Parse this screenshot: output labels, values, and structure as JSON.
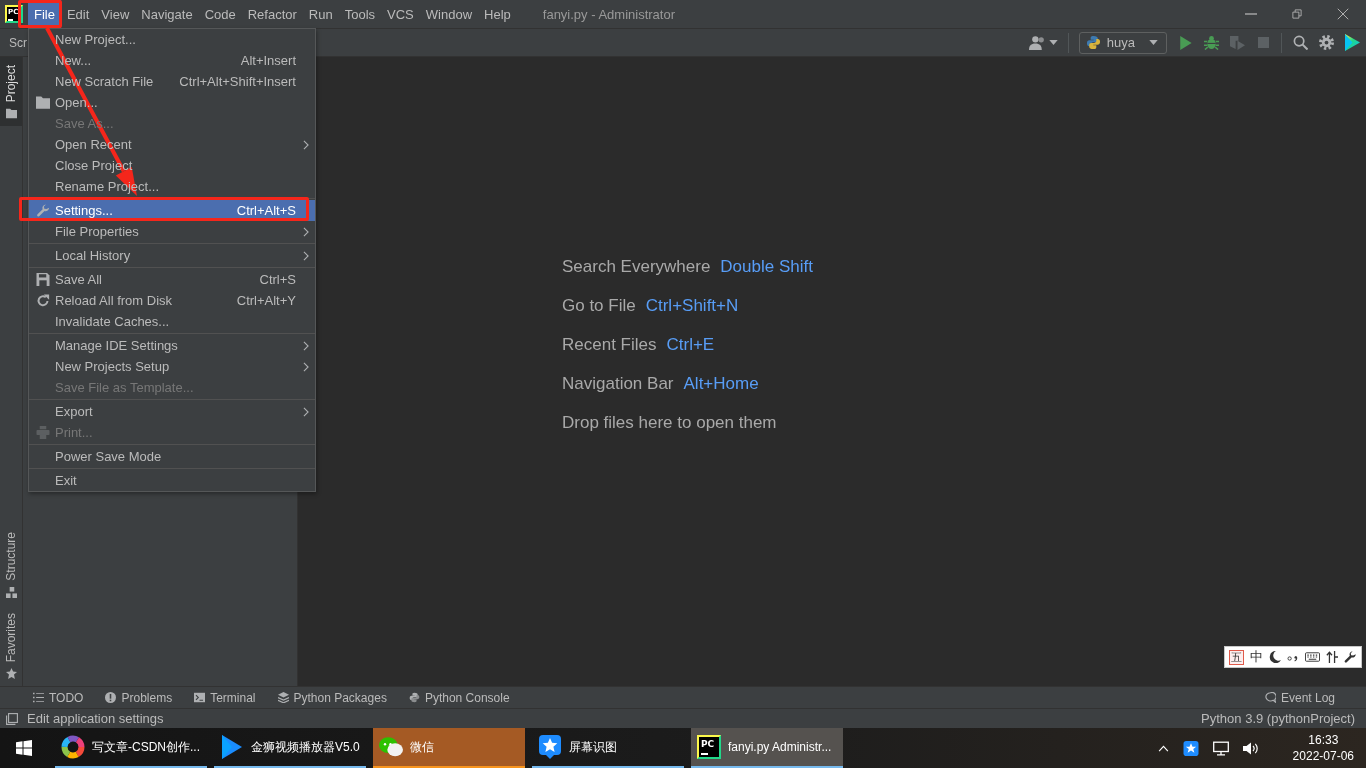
{
  "window": {
    "logo": "PC",
    "title": "fanyi.py - Administrator"
  },
  "menu_bar": [
    {
      "label": "File",
      "selected": true,
      "annotated": true
    },
    {
      "label": "Edit",
      "selected": false,
      "annotated": false
    },
    {
      "label": "View",
      "selected": false,
      "annotated": false
    },
    {
      "label": "Navigate",
      "selected": false,
      "annotated": false
    },
    {
      "label": "Code",
      "selected": false,
      "annotated": false
    },
    {
      "label": "Refactor",
      "selected": false,
      "annotated": false
    },
    {
      "label": "Run",
      "selected": false,
      "annotated": false
    },
    {
      "label": "Tools",
      "selected": false,
      "annotated": false
    },
    {
      "label": "VCS",
      "selected": false,
      "annotated": false
    },
    {
      "label": "Window",
      "selected": false,
      "annotated": false
    },
    {
      "label": "Help",
      "selected": false,
      "annotated": false
    }
  ],
  "nav_bar": {
    "breadcrumb": "Scr"
  },
  "toolbar": {
    "run_config": "huya"
  },
  "file_menu": {
    "groups": [
      {
        "items": [
          {
            "label": "New Project...",
            "kind": "plain",
            "submenu": false,
            "disabled": false,
            "selected": false,
            "annotated": false
          },
          {
            "label": "New...",
            "kind": "plain",
            "shortcut": "Alt+Insert",
            "submenu": false,
            "disabled": false,
            "selected": false,
            "annotated": false
          },
          {
            "label": "New Scratch File",
            "kind": "plain",
            "shortcut": "Ctrl+Alt+Shift+Insert",
            "submenu": false,
            "disabled": false,
            "selected": false,
            "annotated": false
          },
          {
            "label": "Open...",
            "kind": "folder",
            "submenu": false,
            "disabled": false,
            "selected": false,
            "annotated": false
          },
          {
            "label": "Save As...",
            "kind": "plain",
            "submenu": false,
            "disabled": true,
            "selected": false,
            "annotated": false
          },
          {
            "label": "Open Recent",
            "kind": "plain",
            "submenu": true,
            "disabled": false,
            "selected": false,
            "annotated": false
          },
          {
            "label": "Close Project",
            "kind": "plain",
            "submenu": false,
            "disabled": false,
            "selected": false,
            "annotated": false
          },
          {
            "label": "Rename Project...",
            "kind": "plain",
            "submenu": false,
            "disabled": false,
            "selected": false,
            "annotated": false
          }
        ]
      },
      {
        "items": [
          {
            "label": "Settings...",
            "kind": "wrench",
            "shortcut": "Ctrl+Alt+S",
            "submenu": false,
            "disabled": false,
            "selected": true,
            "annotated": true
          },
          {
            "label": "File Properties",
            "kind": "plain",
            "submenu": true,
            "disabled": false,
            "selected": false,
            "annotated": false
          }
        ]
      },
      {
        "items": [
          {
            "label": "Local History",
            "kind": "plain",
            "submenu": true,
            "disabled": false,
            "selected": false,
            "annotated": false
          }
        ]
      },
      {
        "items": [
          {
            "label": "Save All",
            "kind": "disk",
            "shortcut": "Ctrl+S",
            "submenu": false,
            "disabled": false,
            "selected": false,
            "annotated": false
          },
          {
            "label": "Reload All from Disk",
            "kind": "reload",
            "shortcut": "Ctrl+Alt+Y",
            "submenu": false,
            "disabled": false,
            "selected": false,
            "annotated": false
          },
          {
            "label": "Invalidate Caches...",
            "kind": "plain",
            "submenu": false,
            "disabled": false,
            "selected": false,
            "annotated": false
          }
        ]
      },
      {
        "items": [
          {
            "label": "Manage IDE Settings",
            "kind": "plain",
            "submenu": true,
            "disabled": false,
            "selected": false,
            "annotated": false
          },
          {
            "label": "New Projects Setup",
            "kind": "plain",
            "submenu": true,
            "disabled": false,
            "selected": false,
            "annotated": false
          },
          {
            "label": "Save File as Template...",
            "kind": "plain",
            "submenu": false,
            "disabled": true,
            "selected": false,
            "annotated": false
          }
        ]
      },
      {
        "items": [
          {
            "label": "Export",
            "kind": "plain",
            "submenu": true,
            "disabled": false,
            "selected": false,
            "annotated": false
          },
          {
            "label": "Print...",
            "kind": "printer",
            "submenu": false,
            "disabled": true,
            "selected": false,
            "annotated": false
          }
        ]
      },
      {
        "items": [
          {
            "label": "Power Save Mode",
            "kind": "plain",
            "submenu": false,
            "disabled": false,
            "selected": false,
            "annotated": false
          }
        ]
      },
      {
        "items": [
          {
            "label": "Exit",
            "kind": "plain",
            "submenu": false,
            "disabled": false,
            "selected": false,
            "annotated": false
          }
        ]
      }
    ]
  },
  "tool_stripe": {
    "top": [
      {
        "label": "Project",
        "kind": "folder",
        "selected": true
      }
    ],
    "bottom": [
      {
        "label": "Structure",
        "kind": "structure",
        "selected": false
      },
      {
        "label": "Favorites",
        "kind": "favorites",
        "selected": false
      }
    ]
  },
  "editor": {
    "hints": [
      {
        "label": "Search Everywhere",
        "shortcut": "Double Shift"
      },
      {
        "label": "Go to File",
        "shortcut": "Ctrl+Shift+N"
      },
      {
        "label": "Recent Files",
        "shortcut": "Ctrl+E"
      },
      {
        "label": "Navigation Bar",
        "shortcut": "Alt+Home"
      },
      {
        "label": "Drop files here to open them"
      }
    ]
  },
  "ime_toolbar": {
    "scheme": "五",
    "mode": "中"
  },
  "tool_windows": {
    "left": [
      {
        "label": "TODO",
        "kind": "todo"
      },
      {
        "label": "Problems",
        "kind": "problems"
      },
      {
        "label": "Terminal",
        "kind": "terminal"
      },
      {
        "label": "Python Packages",
        "kind": "packages"
      },
      {
        "label": "Python Console",
        "kind": "console"
      }
    ],
    "right": [
      {
        "label": "Event Log",
        "kind": "log"
      }
    ]
  },
  "status_bar": {
    "message": "Edit application settings",
    "interpreter": "Python 3.9 (pythonProject)"
  },
  "taskbar": {
    "items": [
      {
        "label": "写文章-CSDN创作...",
        "kind": "browser",
        "selected": false,
        "flashing": false
      },
      {
        "label": "金狮视频播放器V5.0",
        "kind": "player",
        "selected": false,
        "flashing": false
      },
      {
        "label": "微信",
        "kind": "chat",
        "selected": false,
        "flashing": true
      },
      {
        "label": "屏幕识图",
        "kind": "capture",
        "selected": false,
        "flashing": false
      },
      {
        "label": "fanyi.py Administr...",
        "kind": "ide",
        "icon_text": "PC",
        "selected": true,
        "flashing": false
      }
    ],
    "time": "16:33",
    "date": "2022-07-06"
  }
}
